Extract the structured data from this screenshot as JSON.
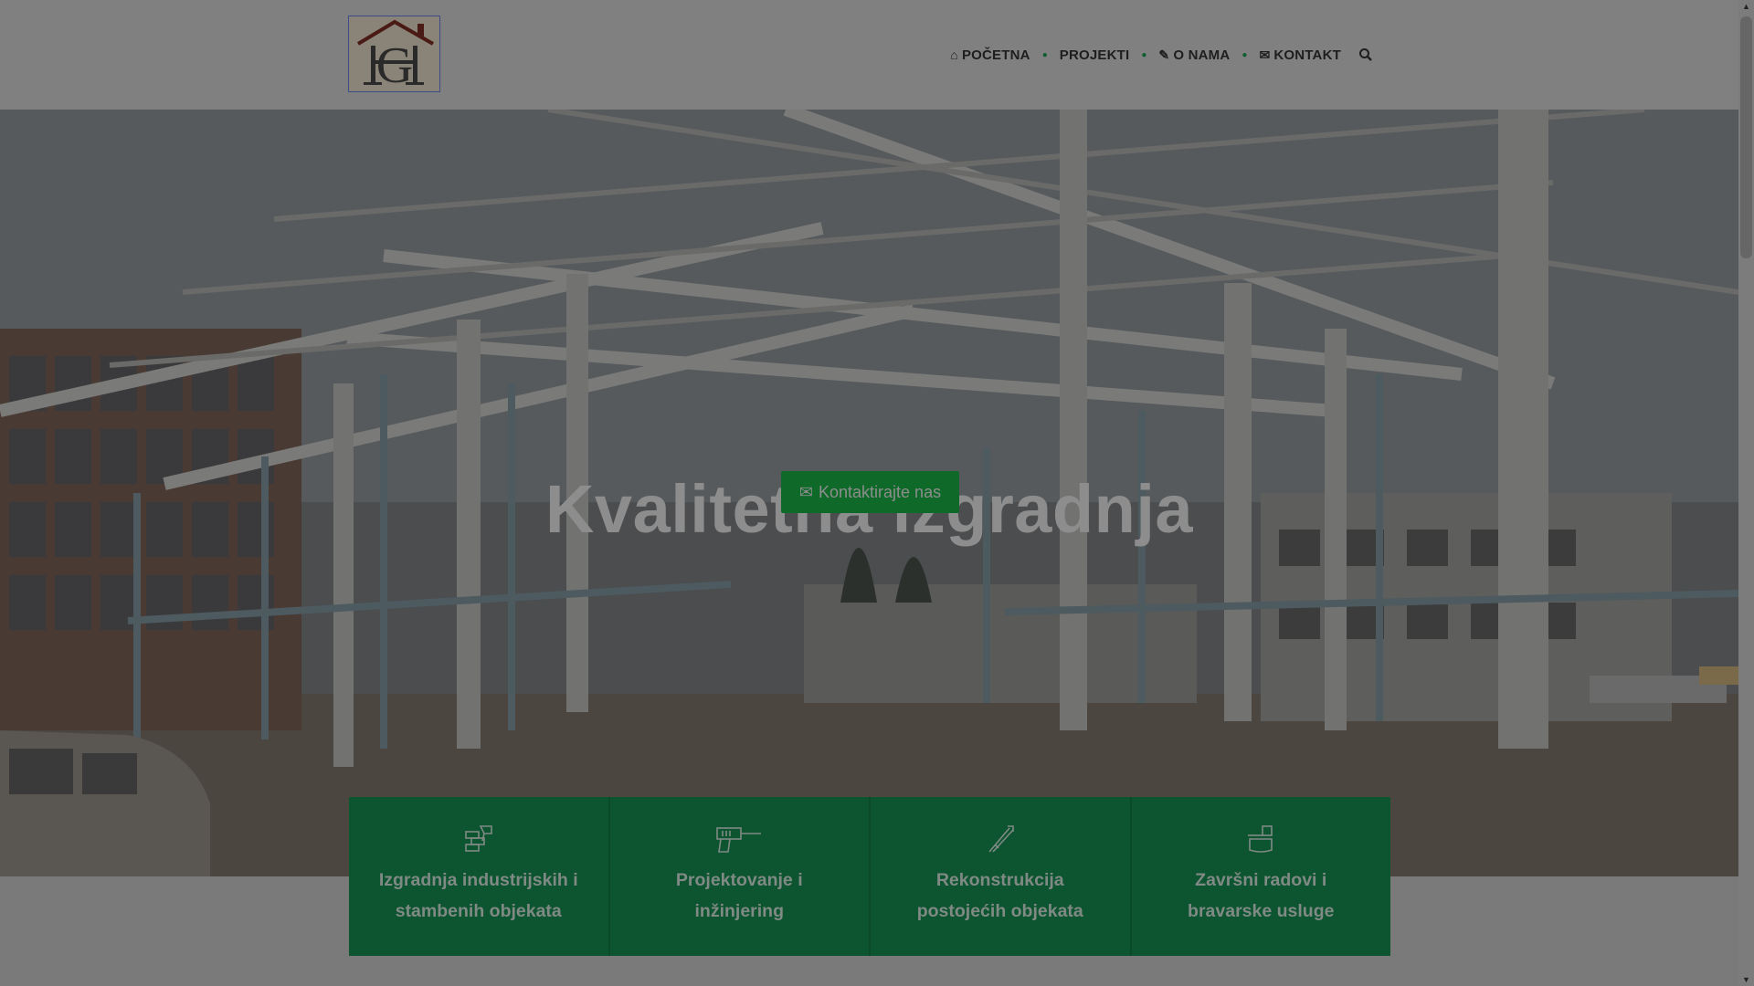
{
  "header": {
    "logo_alt": "HG",
    "nav": [
      {
        "label": "POČETNA",
        "icon": "home-icon"
      },
      {
        "label": "PROJEKTI",
        "icon": ""
      },
      {
        "label": "O NAMA",
        "icon": "edit-icon"
      },
      {
        "label": "KONTAKT",
        "icon": "envelope-icon"
      }
    ],
    "search_icon": "search-icon"
  },
  "hero": {
    "title": "Kvalitetna izgradnja",
    "button_label": "Kontaktirajte nas",
    "button_icon": "envelope-icon"
  },
  "services": [
    {
      "label": "Izgradnja industrijskih i stambenih objekata",
      "icon": "bricks-trowel-icon"
    },
    {
      "label": "Projektovanje i inžinjering",
      "icon": "drill-icon"
    },
    {
      "label": "Rekonstrukcija postojećih objekata",
      "icon": "tools-icon"
    },
    {
      "label": "Završni radovi i bravarske usluge",
      "icon": "paint-roller-icon"
    }
  ],
  "colors": {
    "accent_green": "#0d5430",
    "button_green": "#0f6a2a",
    "overlay": "#808080"
  }
}
